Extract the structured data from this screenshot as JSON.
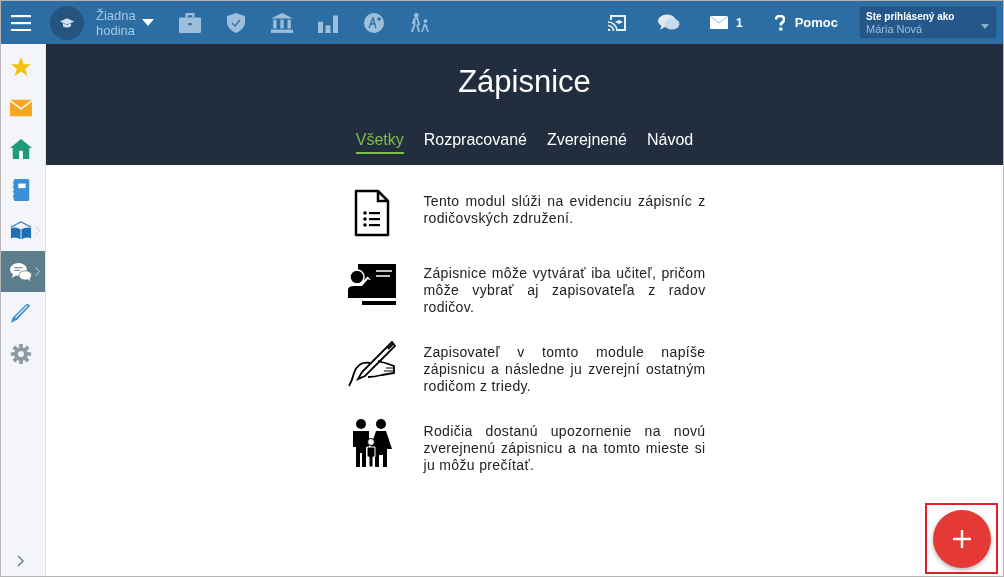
{
  "top_bar": {
    "lesson": {
      "line_1": "Žiadna",
      "line_2": "hodina"
    },
    "messages_count": "1",
    "help": "Pomoc",
    "user": {
      "caption": "Ste prihlásený ako",
      "name": "Mária Nová"
    }
  },
  "sidebar": {
    "items": [
      {
        "selected": false,
        "has_submenu": false
      },
      {
        "selected": false,
        "has_submenu": false
      },
      {
        "selected": false,
        "has_submenu": false
      },
      {
        "selected": false,
        "has_submenu": false
      },
      {
        "selected": false,
        "has_submenu": true
      },
      {
        "selected": true,
        "has_submenu": true
      },
      {
        "selected": false,
        "has_submenu": false
      },
      {
        "selected": false,
        "has_submenu": false
      }
    ]
  },
  "page": {
    "title": "Zápisnice",
    "tabs": [
      {
        "label": "Všetky",
        "selected": true
      },
      {
        "label": "Rozpracované",
        "selected": false
      },
      {
        "label": "Zverejnené",
        "selected": false
      },
      {
        "label": "Návod",
        "selected": false
      }
    ],
    "info": [
      {
        "text": "Tento modul slúži na evidenciu zápisníc z rodičovských združení."
      },
      {
        "text": "Zápisnice môže vytvárať iba učiteľ, pričom môže vybrať aj zapisovateľa z radov rodičov."
      },
      {
        "text": "Zapisovateľ v tomto module napíše zápisnicu a následne ju zverejní ostatným rodičom z triedy."
      },
      {
        "text": "Rodičia dostanú upozornenie na novú zverejnenú zápisnicu a na tomto mieste si ju môžu prečítať."
      }
    ]
  },
  "add_button": {
    "highlighted": true
  }
}
